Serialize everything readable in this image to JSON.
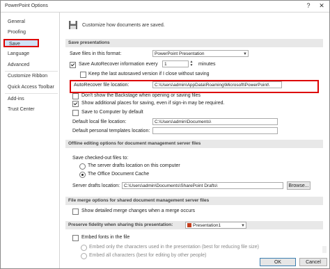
{
  "window": {
    "title": "PowerPoint Options",
    "help_label": "?",
    "close_label": "✕"
  },
  "sidebar": {
    "items": [
      {
        "label": "General"
      },
      {
        "label": "Proofing"
      },
      {
        "label": "Save"
      },
      {
        "label": "Language"
      },
      {
        "label": "Advanced"
      },
      {
        "label": "Customize Ribbon"
      },
      {
        "label": "Quick Access Toolbar"
      },
      {
        "label": "Add-ins"
      },
      {
        "label": "Trust Center"
      }
    ],
    "selected": "Save"
  },
  "header": {
    "text": "Customize how documents are saved."
  },
  "save_presentations": {
    "heading": "Save presentations",
    "format_label": "Save files in this format:",
    "format_value": "PowerPoint Presentation",
    "autorecover_label": "Save AutoRecover information every",
    "autorecover_minutes": "1",
    "minutes_label": "minutes",
    "keep_last_label": "Keep the last autosaved version if I close without saving",
    "autorecover_location_label": "AutoRecover file location:",
    "autorecover_location_value": "C:\\Users\\admin\\AppData\\Roaming\\Microsoft\\PowerPoint\\",
    "dont_show_backstage_label": "Don't show the Backstage when opening or saving files",
    "show_additional_places_label": "Show additional places for saving, even if sign-in may be required.",
    "save_to_computer_label": "Save to Computer by default",
    "default_local_label": "Default local file location:",
    "default_local_value": "C:\\Users\\admin\\Documents\\",
    "default_personal_label": "Default personal templates location:",
    "default_personal_value": ""
  },
  "offline": {
    "heading": "Offline editing options for document management server files",
    "save_checked_out_label": "Save checked-out files to:",
    "server_drafts_option": "The server drafts location on this computer",
    "office_cache_option": "The Office Document Cache",
    "server_drafts_label": "Server drafts location:",
    "server_drafts_value": "C:\\Users\\admin\\Documents\\SharePoint Drafts\\",
    "browse_label": "Browse..."
  },
  "merge": {
    "heading": "File merge options for shared document management server files",
    "show_detailed_label": "Show detailed merge changes when a merge occurs"
  },
  "fidelity": {
    "heading": "Preserve fidelity when sharing this presentation:",
    "presentation_value": "Presentation1",
    "embed_fonts_label": "Embed fonts in the file",
    "embed_only_label": "Embed only the characters used in the presentation (best for reducing file size)",
    "embed_all_label": "Embed all characters (best for editing by other people)"
  },
  "footer": {
    "ok_label": "OK",
    "cancel_label": "Cancel"
  }
}
